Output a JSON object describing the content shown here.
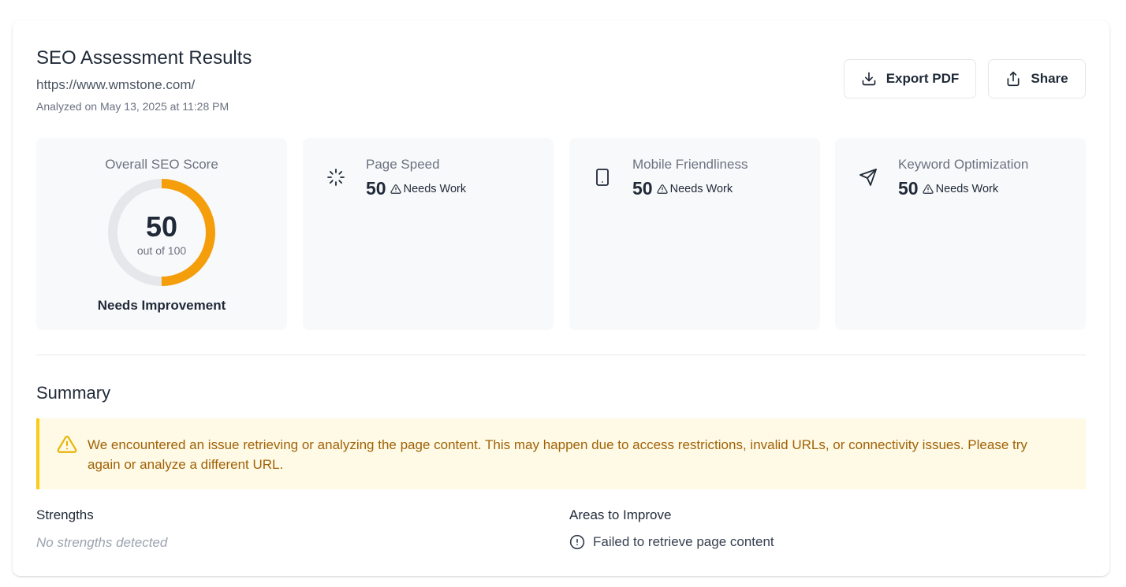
{
  "header": {
    "title": "SEO Assessment Results",
    "url": "https://www.wmstone.com/",
    "analyzed": "Analyzed on May 13, 2025 at 11:28 PM"
  },
  "actions": {
    "export_label": "Export PDF",
    "export_icon": "download-icon",
    "share_label": "Share",
    "share_icon": "share-icon"
  },
  "overall": {
    "label": "Overall SEO Score",
    "score": "50",
    "max_text": "out of 100",
    "score_fraction": 0.5,
    "status": "Needs Improvement",
    "ring_color": "#f59e0b",
    "track_color": "#e5e7eb"
  },
  "metrics": [
    {
      "label": "Page Speed",
      "value": "50",
      "status": "Needs Work",
      "icon": "loader-icon"
    },
    {
      "label": "Mobile Friendliness",
      "value": "50",
      "status": "Needs Work",
      "icon": "tablet-icon"
    },
    {
      "label": "Keyword Optimization",
      "value": "50",
      "status": "Needs Work",
      "icon": "send-icon"
    }
  ],
  "summary": {
    "title": "Summary",
    "warning_icon": "warning-triangle-icon",
    "warning_text": "We encountered an issue retrieving or analyzing the page content. This may happen due to access restrictions, invalid URLs, or connectivity issues. Please try again or analyze a different URL."
  },
  "strengths": {
    "title": "Strengths",
    "empty_text": "No strengths detected"
  },
  "improve": {
    "title": "Areas to Improve",
    "items": [
      {
        "text": "Failed to retrieve page content",
        "icon": "alert-circle-icon"
      }
    ]
  }
}
